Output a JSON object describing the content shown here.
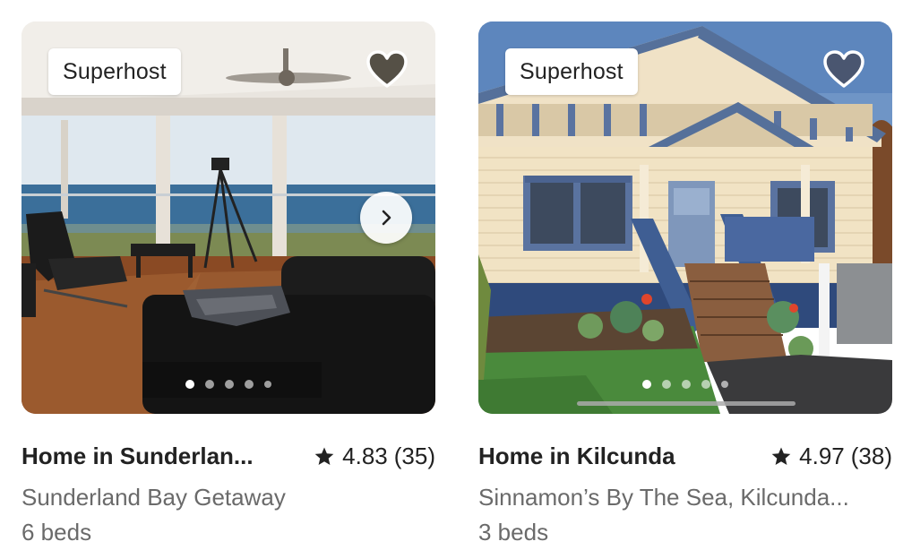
{
  "listings": [
    {
      "badge": "Superhost",
      "title": "Home in Sunderlan...",
      "rating": "4.83",
      "review_count": "(35)",
      "subtitle": "Sunderland Bay Getaway",
      "beds": "6 beds",
      "photo_count": 5,
      "active_photo": 1,
      "saved": true,
      "heart_color": "#555046",
      "photo_icon": "living-room-ocean-view"
    },
    {
      "badge": "Superhost",
      "title": "Home in Kilcunda",
      "rating": "4.97",
      "review_count": "(38)",
      "subtitle": "Sinnamon’s By The Sea, Kilcunda...",
      "beds": "3 beds",
      "photo_count": 5,
      "active_photo": 1,
      "saved": true,
      "heart_color": "#4a5670",
      "photo_icon": "weatherboard-cottage-exterior"
    }
  ],
  "icons": {
    "heart": "heart-icon",
    "star": "star-icon",
    "next": "chevron-right-icon"
  }
}
